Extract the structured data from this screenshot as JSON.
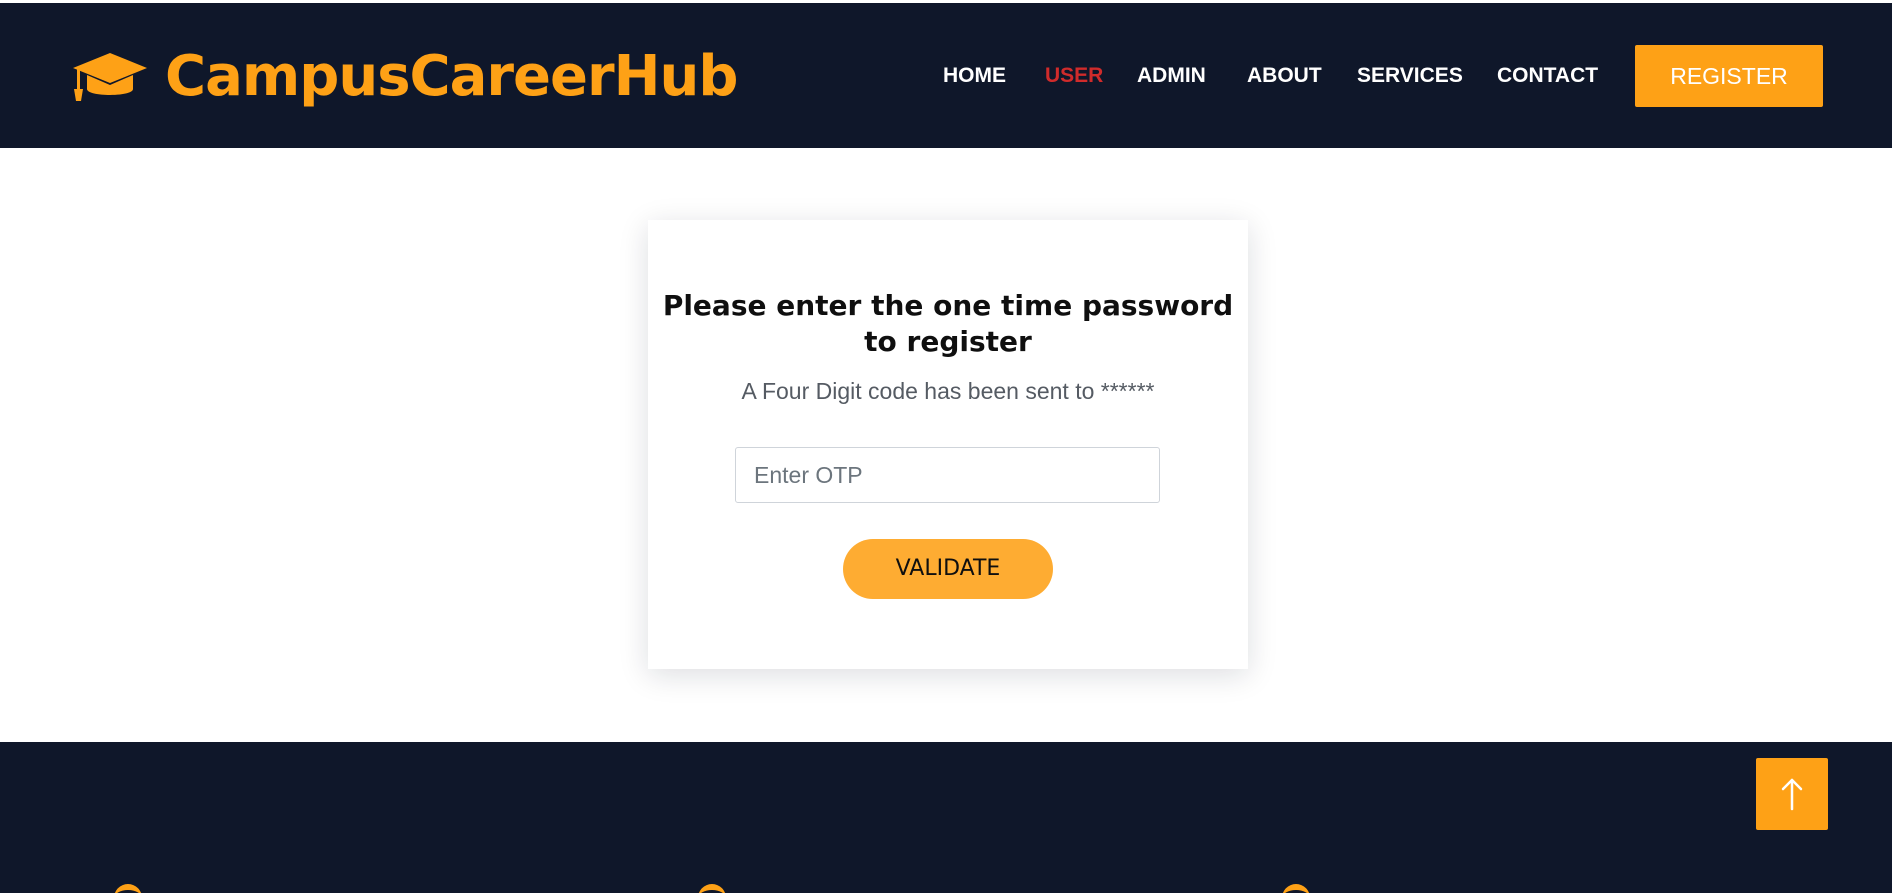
{
  "brand": {
    "name": "CampusCareerHub",
    "icon": "graduation-cap-icon"
  },
  "nav": {
    "items": [
      {
        "label": "HOME",
        "active": false
      },
      {
        "label": "USER",
        "active": true
      },
      {
        "label": "ADMIN",
        "active": false
      },
      {
        "label": "ABOUT",
        "active": false
      },
      {
        "label": "SERVICES",
        "active": false
      },
      {
        "label": "CONTACT",
        "active": false
      }
    ],
    "register_label": "REGISTER"
  },
  "otp_card": {
    "title": "Please enter the one time password to register",
    "subtitle": "A Four Digit code has been sent to ******",
    "input_placeholder": "Enter OTP",
    "input_value": "",
    "validate_label": "VALIDATE"
  },
  "back_to_top": {
    "icon": "arrow-up-icon"
  },
  "colors": {
    "navbar_bg": "#0f172a",
    "accent": "#fea116",
    "active_nav": "#d02b2b",
    "footer_bg": "#0f172a"
  }
}
